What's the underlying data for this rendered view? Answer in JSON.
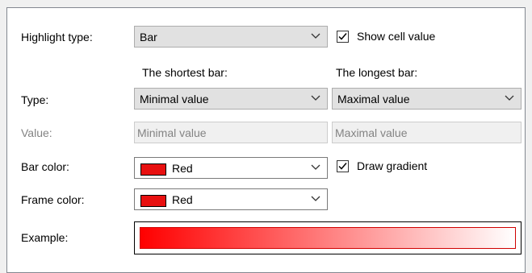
{
  "highlight": {
    "label": "Highlight type:",
    "value": "Bar"
  },
  "show_cell_value": {
    "label": "Show cell value",
    "checked": true
  },
  "columns": {
    "shortest": "The shortest bar:",
    "longest": "The longest bar:"
  },
  "type": {
    "label": "Type:",
    "shortest_value": "Minimal value",
    "longest_value": "Maximal value"
  },
  "value": {
    "label": "Value:",
    "shortest_placeholder": "Minimal value",
    "longest_placeholder": "Maximal value"
  },
  "bar_color": {
    "label": "Bar color:",
    "value": "Red",
    "color": "#e81010"
  },
  "draw_gradient": {
    "label": "Draw gradient",
    "checked": true
  },
  "frame_color": {
    "label": "Frame color:",
    "value": "Red",
    "color": "#e81010"
  },
  "example": {
    "label": "Example:"
  }
}
